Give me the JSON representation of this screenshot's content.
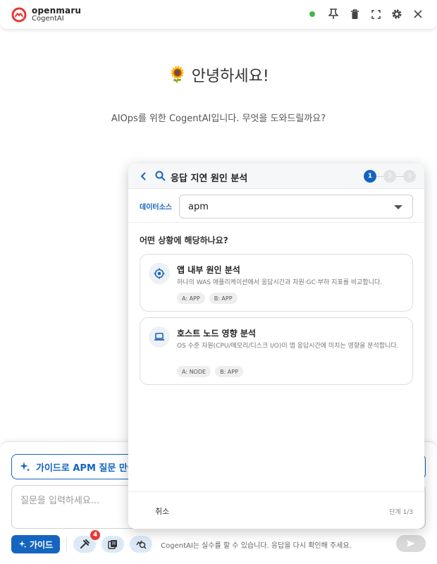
{
  "app": {
    "brand": "openmaru",
    "product": "CogentAI",
    "colors": {
      "accent": "#1565c0",
      "logo": "#e53935",
      "status": "#43b649"
    },
    "titlebar_icons": [
      "status-dot",
      "pin-icon",
      "trash-icon",
      "fullscreen-icon",
      "gear-icon",
      "close-icon"
    ]
  },
  "welcome": {
    "emoji": "🌻",
    "greeting": "안녕하세요!",
    "subtitle": "AIOps를 위한 CogentAI입니다. 무엇을 도와드릴까요?"
  },
  "composer": {
    "guide_button_label": "가이드로 APM 질문 만들",
    "question_placeholder": "질문을 입력하세요...",
    "guide_pill_label": "가이드",
    "tools_badge": "4",
    "disclaimer": "CogentAI는 실수를 할 수 있습니다. 응답을 다시 확인해 주세요."
  },
  "panel": {
    "title": "응답 지연 원인 분석",
    "steps": [
      "1",
      "2",
      "3"
    ],
    "datasource_label": "데이터소스",
    "datasource_value": "apm",
    "question": "어떤 상황에 해당하나요?",
    "options": [
      {
        "icon": "target-icon",
        "title": "앱 내부 원인 분석",
        "description": "하나의 WAS 애플리케이션에서 응답시간과 자원·GC·부하 지표를 비교합니다.",
        "tags": [
          "A: APP",
          "B: APP"
        ]
      },
      {
        "icon": "laptop-icon",
        "title": "호스트 노드 영향 분석",
        "description": "OS 수준 자원(CPU/메모리/디스크 I/O)이 앱 응답시간에 미치는 영향을 분석합니다.",
        "tags": [
          "A: NODE",
          "B: APP"
        ]
      }
    ],
    "cancel_label": "취소",
    "step_counter": "단계 1/3"
  }
}
